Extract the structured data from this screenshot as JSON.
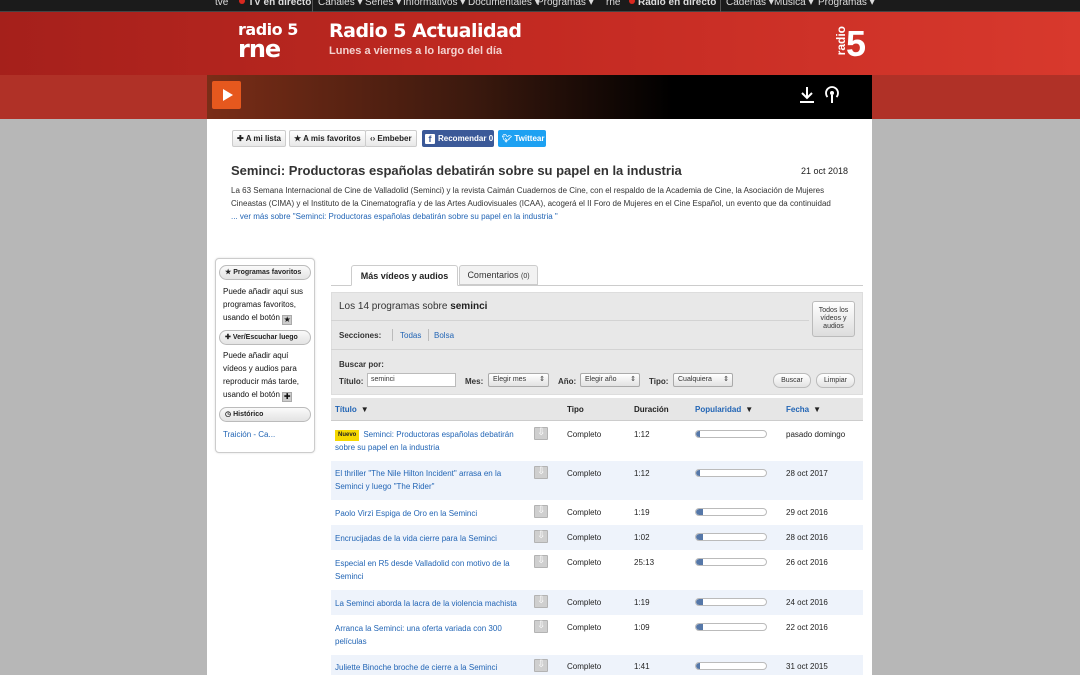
{
  "topbar": {
    "items": [
      "tve",
      "TV en directo",
      "Canales",
      "Series",
      "Informativos",
      "Documentales",
      "Programas",
      "rne",
      "Radio en directo",
      "Cadenas",
      "Música",
      "Programas"
    ]
  },
  "header": {
    "logo_line1": "radio 5",
    "logo_line2": "rne",
    "title": "Radio 5 Actualidad",
    "subtitle": "Lunes a viernes a lo largo del día",
    "badge_text": "radio",
    "badge_num": "5"
  },
  "share": {
    "mi_lista": "A mi lista",
    "favoritos": "A mis favoritos",
    "embeber": "Embeber",
    "recomendar": "Recomendar",
    "recomendar_count": "0",
    "twittear": "Twittear"
  },
  "episode": {
    "title": "Seminci: Productoras españolas debatirán sobre su papel en la industria",
    "date": "21 oct 2018",
    "description": "La 63 Semana Internacional de Cine de Valladolid (Seminci) y la  revista Caimán Cuadernos de Cine, con el respaldo de la Academia de  Cine, la Asociación de Mujeres Cineastas (CIMA) y el Instituto de la  Cinematografía y de las Artes Audiovisuales (ICAA), acogerá el II  Foro de Mujeres en el Cine Español, un evento que da continuidad",
    "more_prefix": "... ",
    "more_link": "ver más sobre \"Seminci: Productoras españolas debatirán sobre su papel en la industria \""
  },
  "sidebar": {
    "fav_head": "Programas favoritos",
    "fav_text": "Puede añadir aquí sus programas favoritos, usando el botón",
    "later_head": "Ver/Escuchar luego",
    "later_text": "Puede añadir aquí vídeos y audios para reproducir más tarde, usando el botón",
    "hist_head": "Histórico",
    "hist_link": "Traición - Ca..."
  },
  "tabs": {
    "more": "Más vídeos y audios",
    "comments": "Comentarios",
    "comments_count": "(0)"
  },
  "search": {
    "count_prefix": "Los 14 programas sobre",
    "keyword": "seminci",
    "all_button": "Todos los vídeos y audios",
    "sections_label": "Secciones:",
    "sections": [
      "Todas",
      "Bolsa"
    ],
    "buscar_por": "Buscar por:",
    "titulo_label": "Título:",
    "titulo_value": "seminci",
    "mes_label": "Mes:",
    "mes_value": "Elegir mes",
    "anio_label": "Año:",
    "anio_value": "Elegir año",
    "tipo_label": "Tipo:",
    "tipo_value": "Cualquiera",
    "buscar_btn": "Buscar",
    "limpiar_btn": "Limpiar"
  },
  "table": {
    "headers": {
      "titulo": "Título",
      "tipo": "Tipo",
      "duracion": "Duración",
      "popularidad": "Popularidad",
      "fecha": "Fecha"
    },
    "new_badge": "Nuevo",
    "rows": [
      {
        "title": "Seminci: Productoras españolas debatirán sobre su papel en la industria",
        "nuevo": true,
        "tipo": "Completo",
        "duracion": "1:12",
        "popularity": 0.05,
        "fecha": "pasado domingo"
      },
      {
        "title": "El thriller \"The Nile Hilton Incident\" arrasa en la Seminci y luego \"The Rider\"",
        "nuevo": false,
        "tipo": "Completo",
        "duracion": "1:12",
        "popularity": 0.05,
        "fecha": "28 oct 2017"
      },
      {
        "title": "Paolo Virzì Espiga de Oro en la Seminci",
        "nuevo": false,
        "tipo": "Completo",
        "duracion": "1:19",
        "popularity": 0.1,
        "fecha": "29 oct 2016"
      },
      {
        "title": "Encrucijadas de la vida cierre para la Seminci",
        "nuevo": false,
        "tipo": "Completo",
        "duracion": "1:02",
        "popularity": 0.1,
        "fecha": "28 oct 2016"
      },
      {
        "title": "Especial en R5 desde Valladolid con motivo de la Seminci",
        "nuevo": false,
        "tipo": "Completo",
        "duracion": "25:13",
        "popularity": 0.1,
        "fecha": "26 oct 2016"
      },
      {
        "title": "La Seminci aborda la lacra de la violencia machista",
        "nuevo": false,
        "tipo": "Completo",
        "duracion": "1:19",
        "popularity": 0.1,
        "fecha": "24 oct 2016"
      },
      {
        "title": "Arranca la Seminci: una oferta variada con 300 películas",
        "nuevo": false,
        "tipo": "Completo",
        "duracion": "1:09",
        "popularity": 0.1,
        "fecha": "22 oct 2016"
      },
      {
        "title": "Juliette Binoche broche de cierre a la Seminci",
        "nuevo": false,
        "tipo": "Completo",
        "duracion": "1:41",
        "popularity": 0.05,
        "fecha": "31 oct 2015"
      }
    ]
  },
  "colors": {
    "brand_red": "#c32a22",
    "link_blue": "#2265b5",
    "play_orange": "#e6581e",
    "facebook": "#3b5998",
    "twitter": "#1da1f2",
    "new_badge": "#f5d800",
    "popularity_fill": "#5577a8"
  }
}
